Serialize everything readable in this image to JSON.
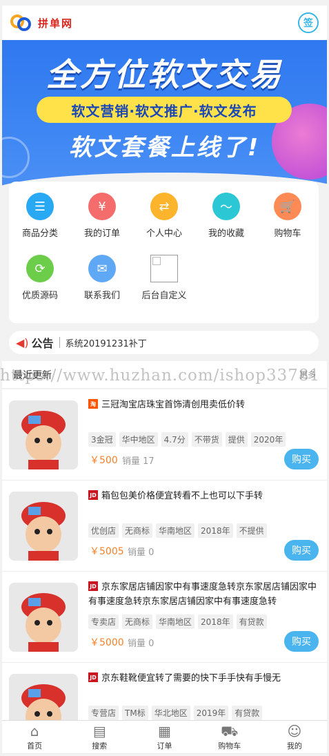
{
  "header": {
    "logo_text": "拼单网",
    "sign_label": "签"
  },
  "banner": {
    "title": "全方位软文交易",
    "pill": "软文营销·软文推广·软文发布",
    "subtitle": "软文套餐上线了!"
  },
  "categories": [
    {
      "label": "商品分类",
      "icon": "list-icon",
      "color": "#29a8f3"
    },
    {
      "label": "我的订单",
      "icon": "yen-icon",
      "color": "#f56c6c"
    },
    {
      "label": "个人中心",
      "icon": "swap-icon",
      "color": "#fbb42c"
    },
    {
      "label": "我的收藏",
      "icon": "trend-icon",
      "color": "#2cc7d5"
    },
    {
      "label": "购物车",
      "icon": "cart-icon",
      "color": "#fe8b56"
    },
    {
      "label": "优质源码",
      "icon": "refresh-icon",
      "color": "#6ccd4a"
    },
    {
      "label": "联系我们",
      "icon": "chat-icon",
      "color": "#5fa8f5"
    },
    {
      "label": "后台自定义",
      "icon": "broken-image-icon",
      "color": "#ffffff"
    }
  ],
  "notice": {
    "title": "公告",
    "text": "系统20191231补丁"
  },
  "section": {
    "title": "最近更新",
    "more": "更多"
  },
  "watermark": "https://www.huzhan.com/ishop33781",
  "products": [
    {
      "platform": "taobao",
      "title": "三冠淘宝店珠宝首饰清创甩卖低价转",
      "tags": [
        "3金冠",
        "华中地区",
        "4.7分",
        "不带货",
        "提供",
        "2020年"
      ],
      "price": "￥500",
      "sales": "销量 17",
      "buy": "购买"
    },
    {
      "platform": "jd",
      "title": "箱包包美价格便宜转看不上也可以下手转",
      "tags": [
        "优创店",
        "无商标",
        "华南地区",
        "2018年",
        "不提供"
      ],
      "price": "￥5005",
      "sales": "销量 0",
      "buy": "购买"
    },
    {
      "platform": "jd",
      "title": "京东家居店铺因家中有事速度急转京东家居店铺因家中有事速度急转京东家居店铺因家中有事速度急转",
      "tags": [
        "专卖店",
        "无商标",
        "华南地区",
        "2018年",
        "有贷款"
      ],
      "price": "￥5000",
      "sales": "销量 0",
      "buy": "购买"
    },
    {
      "platform": "jd",
      "title": "京东鞋靴便宜转了需要的快下手手快有手慢无",
      "tags": [
        "专营店",
        "TM标",
        "华北地区",
        "2019年",
        "有贷款"
      ],
      "price": "",
      "sales": "",
      "buy": ""
    }
  ],
  "tabbar": [
    {
      "label": "首页",
      "icon": "home-icon"
    },
    {
      "label": "搜索",
      "icon": "search-doc-icon"
    },
    {
      "label": "订单",
      "icon": "grid-icon"
    },
    {
      "label": "购物车",
      "icon": "cart-icon"
    },
    {
      "label": "我的",
      "icon": "user-icon"
    }
  ]
}
